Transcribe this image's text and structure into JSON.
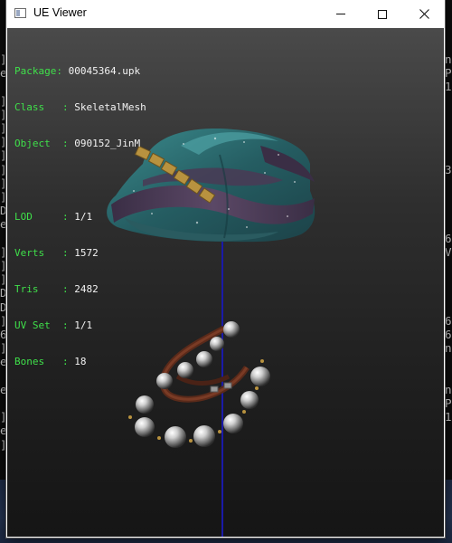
{
  "background_console": {
    "left_chars": [
      "]",
      "e",
      "",
      "]",
      "]",
      "]",
      "]",
      "]",
      "]",
      "]",
      "]",
      "D",
      "e",
      "",
      "]",
      "]",
      "]",
      "D",
      "D",
      "]",
      "6",
      "]",
      "e",
      "",
      "e",
      "",
      "]",
      "e",
      "]"
    ],
    "right_chars": [
      "n",
      "P",
      "1",
      "",
      "",
      "",
      "",
      "",
      "3",
      "",
      "",
      "",
      "",
      "6",
      "V",
      "",
      "",
      "",
      "",
      "6",
      "6",
      "n",
      "",
      "",
      "n",
      "P",
      "1",
      ""
    ]
  },
  "window": {
    "title": "UE Viewer"
  },
  "info_panel": {
    "package": {
      "key": "Package",
      "value": "00045364.upk"
    },
    "class": {
      "key": "Class",
      "value": "SkeletalMesh"
    },
    "object": {
      "key": "Object",
      "value": "090152_JinM"
    },
    "lod": {
      "key": "LOD",
      "value": "1/1"
    },
    "verts": {
      "key": "Verts",
      "value": "1572"
    },
    "tris": {
      "key": "Tris",
      "value": "2482"
    },
    "uv_set": {
      "key": "UV Set",
      "value": "1/1"
    },
    "bones": {
      "key": "Bones",
      "value": "18"
    }
  },
  "colors": {
    "label_green": "#3fe04a",
    "value_white": "#f2f2f2",
    "axis_blue": "#1a1aa8",
    "turban_teal": "#2f6f72",
    "turban_purple": "#4a3a55",
    "gold": "#b8923f"
  }
}
